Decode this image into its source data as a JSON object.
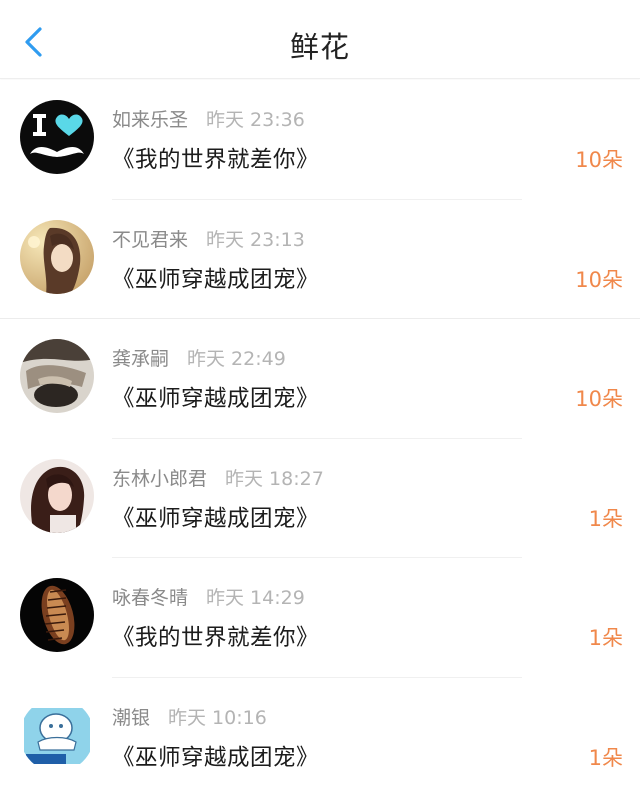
{
  "header": {
    "title": "鲜花",
    "back_icon": "chevron-left-icon",
    "accent_color": "#2f9cf0"
  },
  "count_color": "#f0884b",
  "items": [
    {
      "name": "如来乐圣",
      "time": "昨天 23:36",
      "book": "《我的世界就差你》",
      "count": "10朵"
    },
    {
      "name": "不见君来",
      "time": "昨天 23:13",
      "book": "《巫师穿越成团宠》",
      "count": "10朵"
    },
    {
      "name": "龚承嗣",
      "time": "昨天 22:49",
      "book": "《巫师穿越成团宠》",
      "count": "10朵"
    },
    {
      "name": "东林小郎君",
      "time": "昨天 18:27",
      "book": "《巫师穿越成团宠》",
      "count": "1朵"
    },
    {
      "name": "咏春冬晴",
      "time": "昨天 14:29",
      "book": "《我的世界就差你》",
      "count": "1朵"
    },
    {
      "name": "潮银",
      "time": "昨天 10:16",
      "book": "《巫师穿越成团宠》",
      "count": "1朵"
    }
  ]
}
